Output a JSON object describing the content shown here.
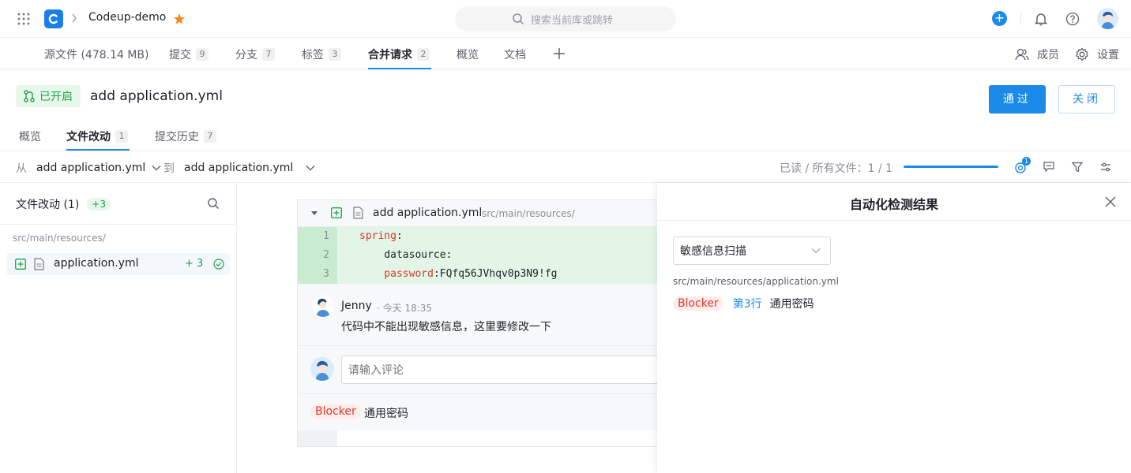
{
  "topbar": {
    "project_name": "Codeup-demo",
    "search_placeholder": "搜索当前库或跳转",
    "plus_label": "+"
  },
  "repo_tabs": [
    {
      "label": "源文件 (478.14 MB)",
      "count": ""
    },
    {
      "label": "提交",
      "count": "9"
    },
    {
      "label": "分支",
      "count": "7"
    },
    {
      "label": "标签",
      "count": "3"
    },
    {
      "label": "合并请求",
      "count": "2",
      "active": true
    },
    {
      "label": "概览",
      "count": ""
    },
    {
      "label": "文档",
      "count": ""
    }
  ],
  "repo_right": {
    "members": "成员",
    "settings": "设置"
  },
  "mr": {
    "status": "已开启",
    "title": "add application.yml",
    "pass_button": "通过",
    "close_button": "关闭",
    "tabs": [
      {
        "label": "概览",
        "count": ""
      },
      {
        "label": "文件改动",
        "count": "1",
        "active": true
      },
      {
        "label": "提交历史",
        "count": "7"
      }
    ]
  },
  "compare": {
    "from_label": "从",
    "from_branch": "add application.yml",
    "to_label": "到",
    "to_branch": "add application.yml",
    "read_status": "已读 / 所有文件：1 / 1",
    "read_progress": 1.0,
    "detect_badge": "1"
  },
  "file_panel": {
    "title": "文件改动 (1)",
    "added": "+3",
    "dir": "src/main/resources/",
    "file_name": "application.yml",
    "file_added": "+ 3"
  },
  "diff": {
    "file_name": "add application.yml",
    "file_path": "src/main/resources/",
    "lines": [
      {
        "num": "1",
        "indent": "",
        "key": "spring",
        "sep": ":",
        "value": ""
      },
      {
        "num": "2",
        "indent": "    ",
        "key": "datasource",
        "sep": ":",
        "value": ""
      },
      {
        "num": "3",
        "indent": "    ",
        "key": "password",
        "sep": ":",
        "value": "FQfq56JVhqv0p3N9!fg"
      }
    ],
    "comment": {
      "author": "Jenny",
      "time": "· 今天 18:35",
      "text": "代码中不能出现敏感信息，这里要修改一下"
    },
    "reply_placeholder": "请输入评论",
    "issue": {
      "level": "Blocker",
      "text": "通用密码"
    }
  },
  "detect_panel": {
    "title": "自动化检测结果",
    "select_value": "敏感信息扫描",
    "path": "src/main/resources/application.yml",
    "result": {
      "level": "Blocker",
      "line": "第3行",
      "text": "通用密码"
    }
  },
  "colors": {
    "accent": "#1b8ae8",
    "green": "#1aa34a",
    "red": "#e03a2f",
    "star": "#f5891f"
  }
}
